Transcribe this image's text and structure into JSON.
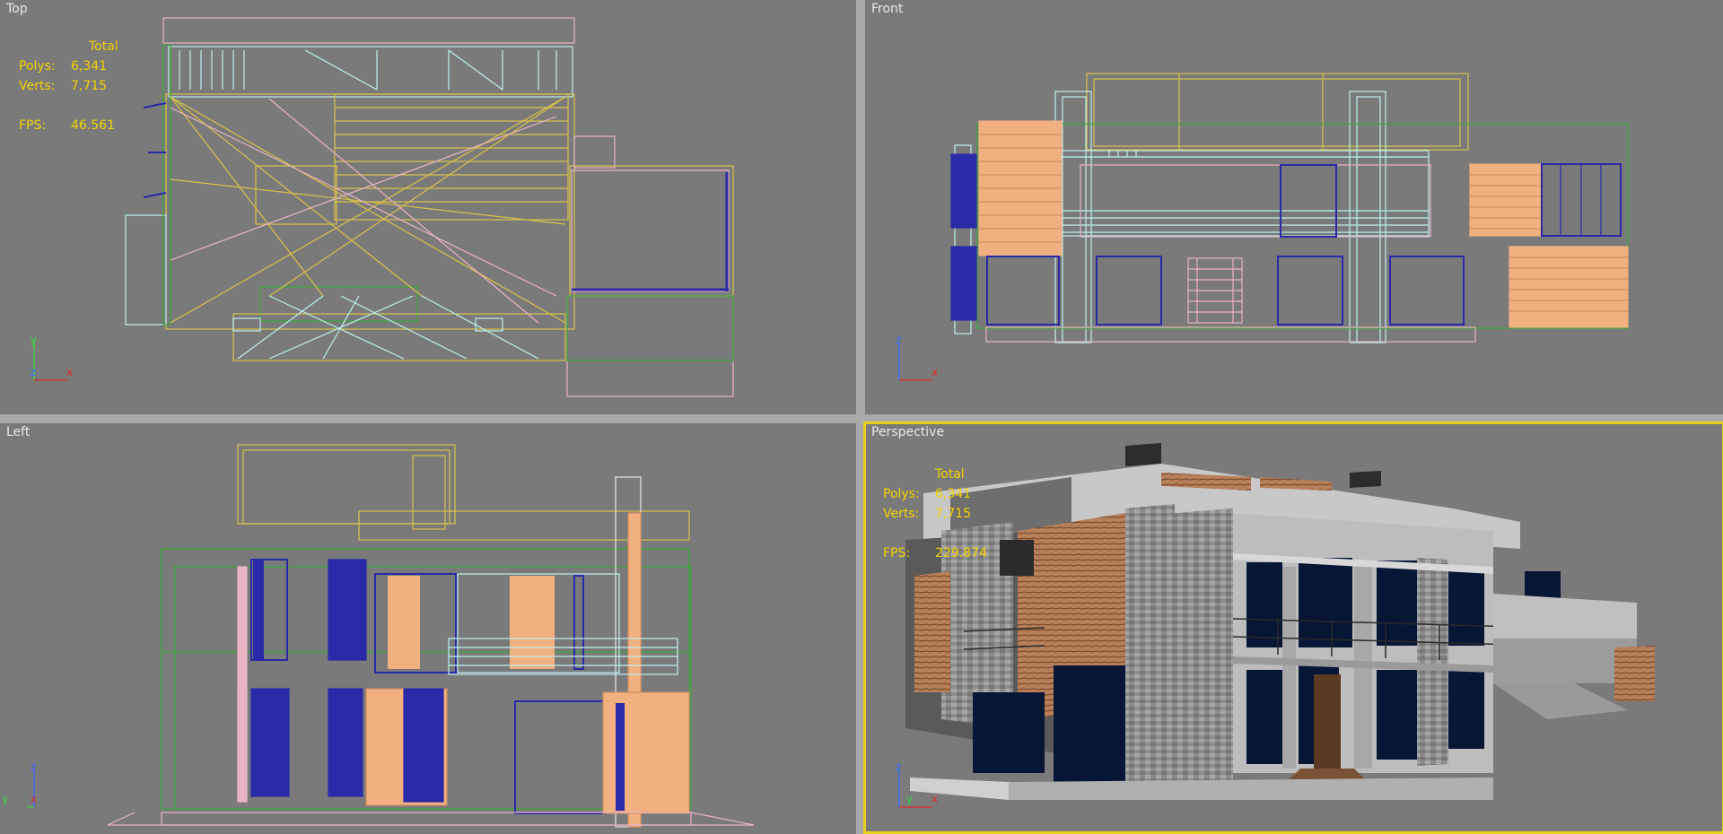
{
  "viewports": {
    "top": {
      "label": "Top"
    },
    "front": {
      "label": "Front"
    },
    "left": {
      "label": "Left"
    },
    "perspective": {
      "label": "Perspective"
    }
  },
  "stats_top": {
    "total_label": "Total",
    "polys_label": "Polys:",
    "polys_value": "6,341",
    "verts_label": "Verts:",
    "verts_value": "7,715",
    "fps_label": "FPS:",
    "fps_value": "46.561"
  },
  "stats_perspective": {
    "total_label": "Total",
    "polys_label": "Polys:",
    "polys_value": "6,341",
    "verts_label": "Verts:",
    "verts_value": "7,715",
    "fps_label": "FPS:",
    "fps_value": "229.874"
  },
  "axes": {
    "top": {
      "a": "y",
      "b": "x",
      "c": "z"
    },
    "front": {
      "a": "z",
      "b": "x"
    },
    "left": {
      "a": "z",
      "b": "y",
      "c": "x"
    },
    "perspective": {
      "a": "z",
      "b": "x",
      "c": "y"
    }
  },
  "colors": {
    "viewport_bg": "#7a7a7a",
    "active_border": "#e6d21d",
    "stats_text": "#f2d300",
    "wire_yellow": "#d8c24a",
    "wire_pink": "#e8b4c4",
    "wire_green": "#3aa83a",
    "wire_cyan": "#bff0f0",
    "wire_blue": "#2a2aa8",
    "wood": "#f0b080",
    "glass": "#0a1a3a",
    "stone": "#a0a0a0"
  }
}
